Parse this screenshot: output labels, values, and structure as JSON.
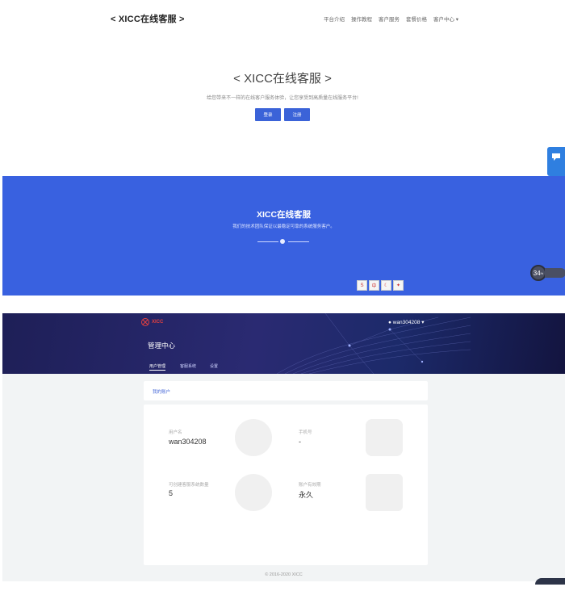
{
  "header": {
    "brand": "< XICC在线客服 >",
    "nav": [
      "平台介绍",
      "操作教程",
      "客户服务",
      "套餐价格",
      "客户中心"
    ]
  },
  "hero": {
    "title": "< XICC在线客服 >",
    "subtitle": "给您带来不一样的在线客户服务体验，让您享受到高质量在线服务平台!",
    "login_label": "登录",
    "register_label": "注册"
  },
  "banner": {
    "title": "XICC在线客服",
    "subtitle": "我们的技术团队保证以最稳定可靠的系统服务客户。"
  },
  "widget": {
    "speed_value": "34",
    "speed_unit": "%"
  },
  "dashboard": {
    "logo_text": "XICC",
    "username": "wan304208",
    "title": "管理中心",
    "tabs": [
      "用户管理",
      "客服系统",
      "设置"
    ],
    "section_title": "我的账户",
    "fields": [
      {
        "label": "用户名",
        "value": "wan304208"
      },
      {
        "label": "手机号",
        "value": "-"
      },
      {
        "label": "可创建客服系统数量",
        "value": "5"
      },
      {
        "label": "账户有效期",
        "value": "永久"
      }
    ],
    "copyright": "© 2016-2020 XICC"
  },
  "colors": {
    "primary_blue": "#3961e0",
    "button_blue": "#3b63d8",
    "dark_header": "#1e1f57"
  }
}
